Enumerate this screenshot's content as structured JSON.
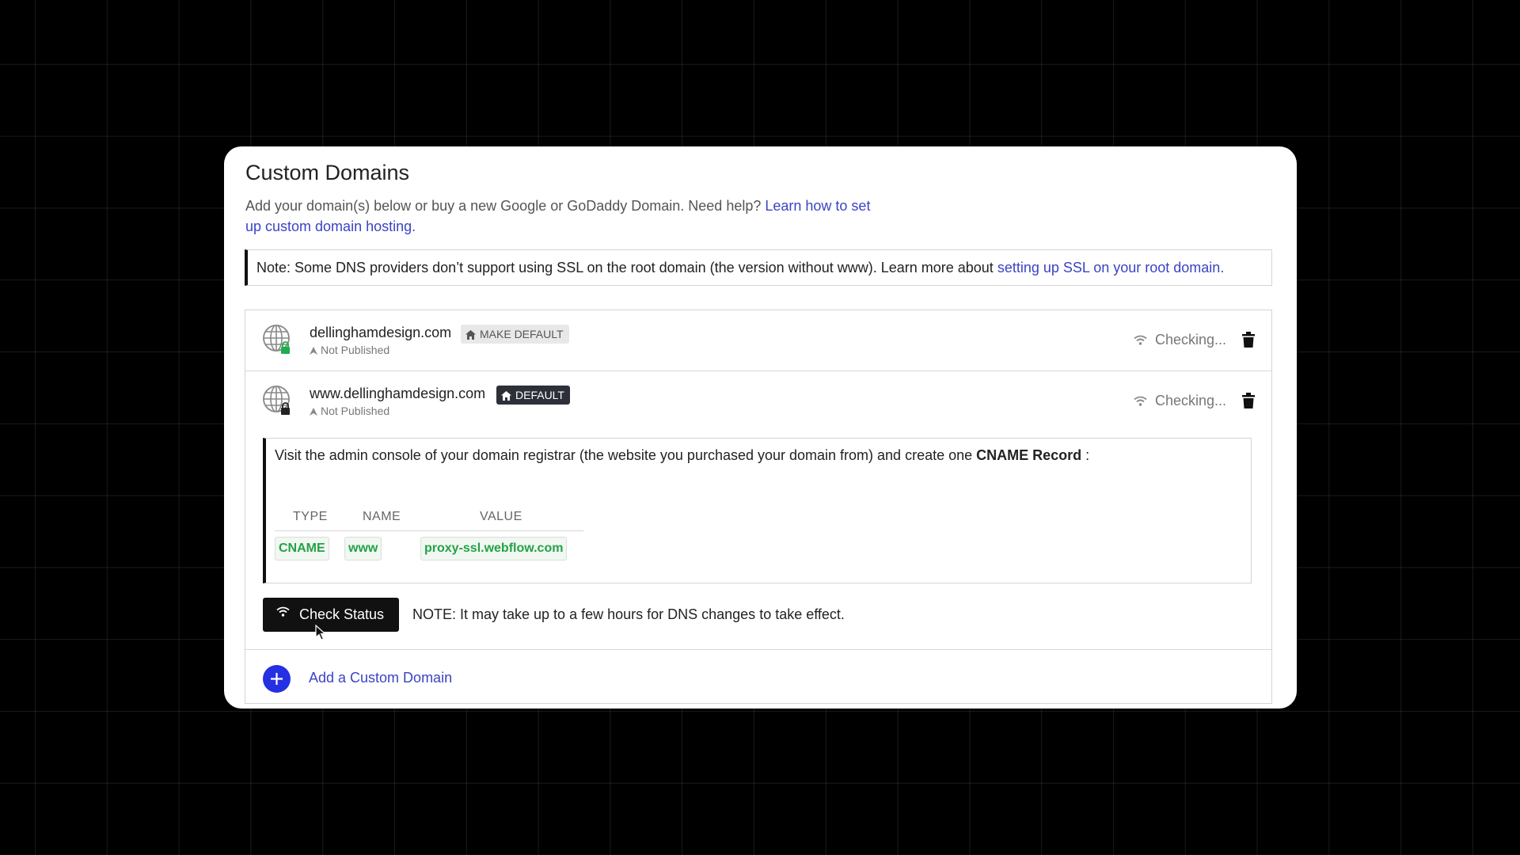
{
  "page": {
    "title": "Custom Domains",
    "intro_text": "Add your domain(s) below or buy a new Google or GoDaddy Domain. Need help? ",
    "intro_link": "Learn how to set up custom domain hosting.",
    "ssl_note_text": "Note: Some DNS providers don’t support using SSL on the root domain (the version without www). Learn more about ",
    "ssl_note_link": "setting up SSL on your root domain."
  },
  "domains": [
    {
      "name": "dellinghamdesign.com",
      "badge": "MAKE DEFAULT",
      "status": "Not Published",
      "check_status": "Checking...",
      "lock_color": "#1fae4b"
    },
    {
      "name": "www.dellinghamdesign.com",
      "badge": "DEFAULT",
      "status": "Not Published",
      "check_status": "Checking...",
      "lock_color": "#222222"
    }
  ],
  "instructions": {
    "text_before": "Visit the admin console of your domain registrar (the website you purchased your domain from) and create one ",
    "record_type_bold": "CNAME Record",
    "text_after": " :",
    "table": {
      "headers": [
        "TYPE",
        "NAME",
        "VALUE"
      ],
      "row": [
        "CNAME",
        "www",
        "proxy-ssl.webflow.com"
      ]
    }
  },
  "actions": {
    "check_status_label": "Check Status",
    "dns_note": "NOTE: It may take up to a few hours for DNS changes to take effect.",
    "add_domain_label": "Add a Custom Domain"
  },
  "colors": {
    "link": "#3b43c4",
    "add_button": "#2530e3",
    "record_value": "#24a148",
    "default_badge": "#2d3039"
  }
}
